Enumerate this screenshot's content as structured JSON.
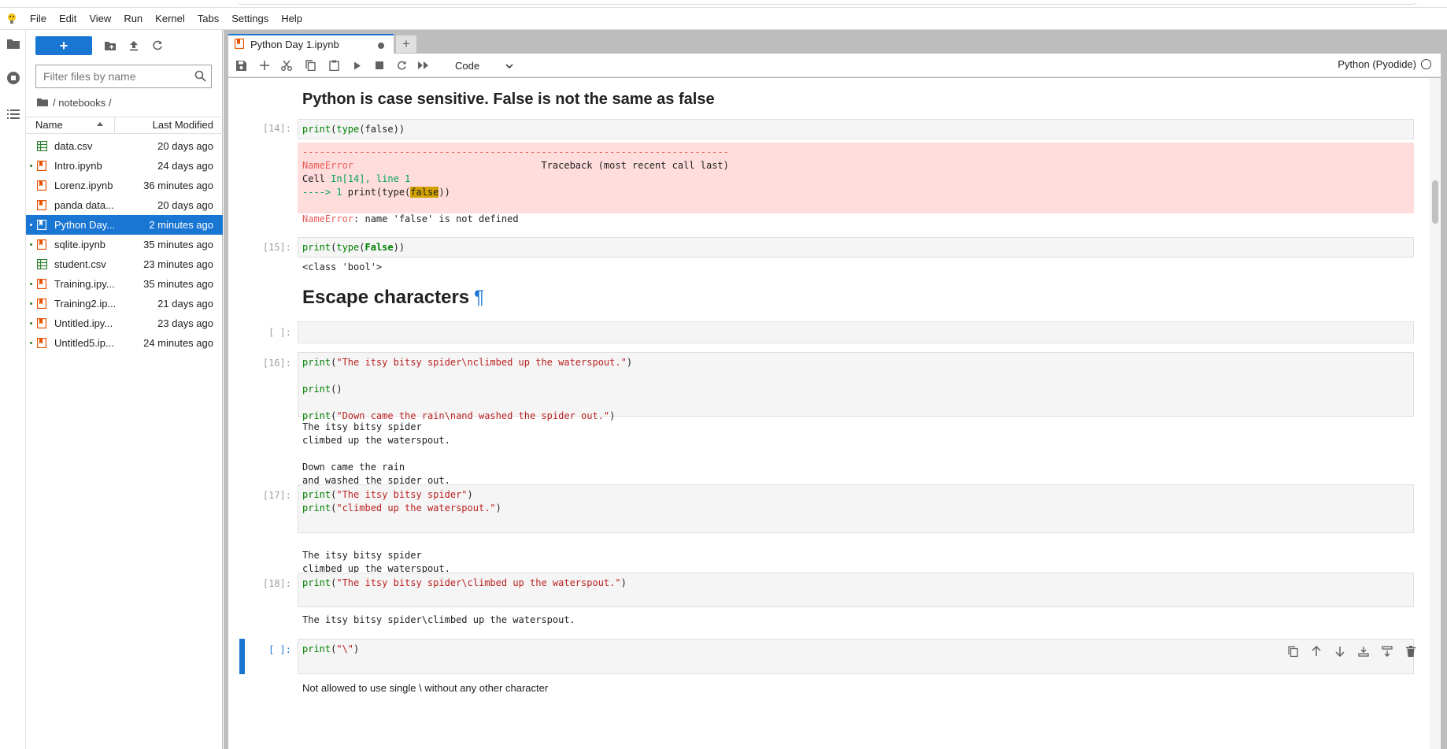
{
  "menubar": {
    "items": [
      "File",
      "Edit",
      "View",
      "Run",
      "Kernel",
      "Tabs",
      "Settings",
      "Help"
    ]
  },
  "filebrowser": {
    "filter_placeholder": "Filter files by name",
    "breadcrumb": "/ notebooks /",
    "col_name": "Name",
    "col_modified": "Last Modified",
    "files": [
      {
        "name": "data.csv",
        "modified": "20 days ago",
        "type": "csv",
        "running": false,
        "selected": false
      },
      {
        "name": "Intro.ipynb",
        "modified": "24 days ago",
        "type": "notebook",
        "running": true,
        "selected": false
      },
      {
        "name": "Lorenz.ipynb",
        "modified": "36 minutes ago",
        "type": "notebook",
        "running": false,
        "selected": false
      },
      {
        "name": "panda data...",
        "modified": "20 days ago",
        "type": "notebook",
        "running": false,
        "selected": false
      },
      {
        "name": "Python Day...",
        "modified": "2 minutes ago",
        "type": "notebook",
        "running": true,
        "selected": true
      },
      {
        "name": "sqlite.ipynb",
        "modified": "35 minutes ago",
        "type": "notebook",
        "running": true,
        "selected": false
      },
      {
        "name": "student.csv",
        "modified": "23 minutes ago",
        "type": "csv",
        "running": false,
        "selected": false
      },
      {
        "name": "Training.ipy...",
        "modified": "35 minutes ago",
        "type": "notebook",
        "running": true,
        "selected": false
      },
      {
        "name": "Training2.ip...",
        "modified": "21 days ago",
        "type": "notebook",
        "running": true,
        "selected": false
      },
      {
        "name": "Untitled.ipy...",
        "modified": "23 days ago",
        "type": "notebook",
        "running": true,
        "selected": false
      },
      {
        "name": "Untitled5.ip...",
        "modified": "24 minutes ago",
        "type": "notebook",
        "running": true,
        "selected": false
      }
    ]
  },
  "tab": {
    "label": "Python Day 1.ipynb",
    "add": "+"
  },
  "toolbar": {
    "cell_type": "Code",
    "kernel_name": "Python (Pyodide)"
  },
  "notebook": {
    "heading_case": "Python is case sensitive. False is not the same as false",
    "cell14": {
      "prompt": "[14]:",
      "code_fn": "print",
      "code_open": "(",
      "code_inner_fn": "type",
      "code_rest": "(false))"
    },
    "error": {
      "dashes": "---------------------------------------------------------------------------",
      "name": "NameError",
      "traceback_label": "Traceback (most recent call last)",
      "cell_line_pre": "Cell ",
      "cell_line_ref": "In[14], line 1",
      "arrow": "----> 1 ",
      "arrow_code_pre": "print(type(",
      "arrow_code_hl": "false",
      "arrow_code_post": "))",
      "final_name": "NameError",
      "final_msg": ": name 'false' is not defined"
    },
    "cell15": {
      "prompt": "[15]:",
      "code_fn": "print",
      "code_open": "(",
      "code_inner_fn": "type",
      "code_paren": "(",
      "code_bool": "False",
      "code_close": "))",
      "output": "<class 'bool'>"
    },
    "heading_escape": "Escape characters",
    "heading_anchor": "¶",
    "empty_prompt": "[ ]:",
    "cell16": {
      "prompt": "[16]:",
      "line1_str": "\"The itsy bitsy spider\\nclimbed up the waterspout.\"",
      "line2": "()",
      "line3_str": "\"Down came the rain\\nand washed the spider out.\"",
      "output": "The itsy bitsy spider\nclimbed up the waterspout.\n\nDown came the rain\nand washed the spider out."
    },
    "cell17": {
      "prompt": "[17]:",
      "line1_str": "\"The itsy bitsy spider\"",
      "line2_str": "\"climbed up the waterspout.\"",
      "output": "The itsy bitsy spider\nclimbed up the waterspout."
    },
    "cell18": {
      "prompt": "[18]:",
      "line1_str": "\"The itsy bitsy spider\\climbed up the waterspout.\"",
      "output": "The itsy bitsy spider\\climbed up the waterspout."
    },
    "cell_active": {
      "prompt": "[ ]:",
      "code_str": "\"\\\"",
      "code_close": ")"
    },
    "note": "Not allowed to use single \\ without any other character",
    "print_kw": "print",
    "open_paren": "(",
    "close_paren": ")"
  },
  "colors": {
    "accent": "#1976d2",
    "error_bg": "#ffdddd",
    "highlight": "#d4a200"
  }
}
